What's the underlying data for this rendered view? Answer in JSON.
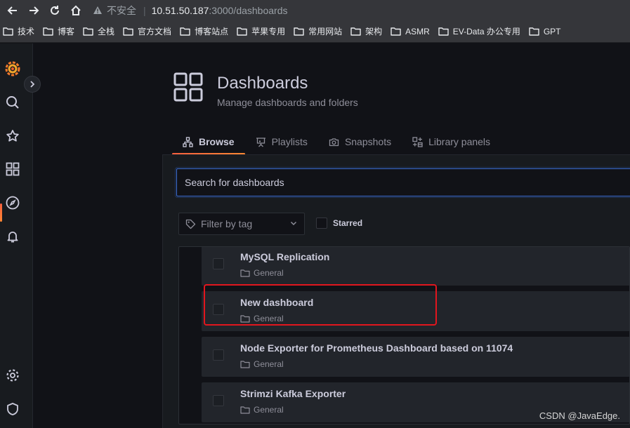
{
  "browser": {
    "security_label": "不安全",
    "url_host": "10.51.50.187",
    "url_path": ":3000/dashboards",
    "bookmarks": [
      "技术",
      "博客",
      "全栈",
      "官方文档",
      "博客站点",
      "苹果专用",
      "常用网站",
      "架构",
      "ASMR",
      "EV-Data 办公专用",
      "GPT"
    ]
  },
  "sidemenu": {
    "items": [
      "grafana-logo",
      "search",
      "starred",
      "dashboards",
      "explore",
      "alerting",
      "configuration",
      "server-admin"
    ],
    "active": "dashboards"
  },
  "page": {
    "title": "Dashboards",
    "subtitle": "Manage dashboards and folders"
  },
  "tabs": [
    {
      "label": "Browse",
      "active": true
    },
    {
      "label": "Playlists",
      "active": false
    },
    {
      "label": "Snapshots",
      "active": false
    },
    {
      "label": "Library panels",
      "active": false
    }
  ],
  "search": {
    "placeholder": "Search for dashboards"
  },
  "filters": {
    "tag_placeholder": "Filter by tag",
    "starred_label": "Starred"
  },
  "dashboards": [
    {
      "title": "MySQL Replication",
      "folder": "General"
    },
    {
      "title": "New dashboard",
      "folder": "General"
    },
    {
      "title": "Node Exporter for Prometheus Dashboard based on 11074",
      "folder": "General"
    },
    {
      "title": "Strimzi Kafka Exporter",
      "folder": "General"
    }
  ],
  "watermark": "CSDN @JavaEdge.",
  "colors": {
    "accent": "#ff8833",
    "highlight_box": "#e2161e",
    "focus": "#3d71d9"
  }
}
